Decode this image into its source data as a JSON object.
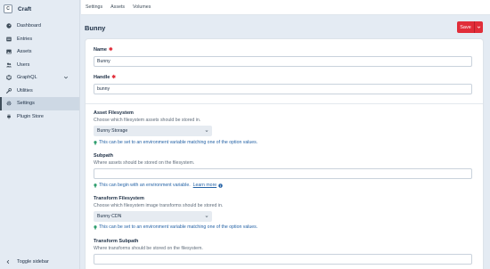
{
  "brand": {
    "logo_letter": "C",
    "name": "Craft"
  },
  "nav": [
    {
      "label": "Dashboard",
      "icon": "dashboard-icon"
    },
    {
      "label": "Entries",
      "icon": "entries-icon"
    },
    {
      "label": "Assets",
      "icon": "image-icon"
    },
    {
      "label": "Users",
      "icon": "users-icon"
    },
    {
      "label": "GraphQL",
      "icon": "graphql-icon"
    },
    {
      "label": "Utilities",
      "icon": "wrench-icon"
    },
    {
      "label": "Settings",
      "icon": "gear-icon"
    },
    {
      "label": "Plugin Store",
      "icon": "plug-icon"
    }
  ],
  "toggle_sidebar": "Toggle sidebar",
  "breadcrumbs": [
    "Settings",
    "Assets",
    "Volumes"
  ],
  "page_title": "Bunny",
  "save_label": "Save",
  "accent_color": "#e12d39",
  "fields": {
    "name": {
      "label": "Name",
      "value": "Bunny"
    },
    "handle": {
      "label": "Handle",
      "value": "bunny"
    },
    "asset_fs": {
      "label": "Asset Filesystem",
      "instructions": "Choose which filesystem assets should be stored in.",
      "value": "Bunny Storage",
      "hint": "This can be set to an environment variable matching one of the option values."
    },
    "subpath": {
      "label": "Subpath",
      "instructions": "Where assets should be stored on the filesystem.",
      "hint": "This can begin with an environment variable.",
      "learn_more": "Learn more"
    },
    "transform_fs": {
      "label": "Transform Filesystem",
      "instructions": "Choose which filesystem image transforms should be stored in.",
      "value": "Bunny CDN",
      "hint": "This can be set to an environment variable matching one of the option values."
    },
    "transform_subpath": {
      "label": "Transform Subpath",
      "instructions": "Where transforms should be stored on the filesystem."
    }
  }
}
